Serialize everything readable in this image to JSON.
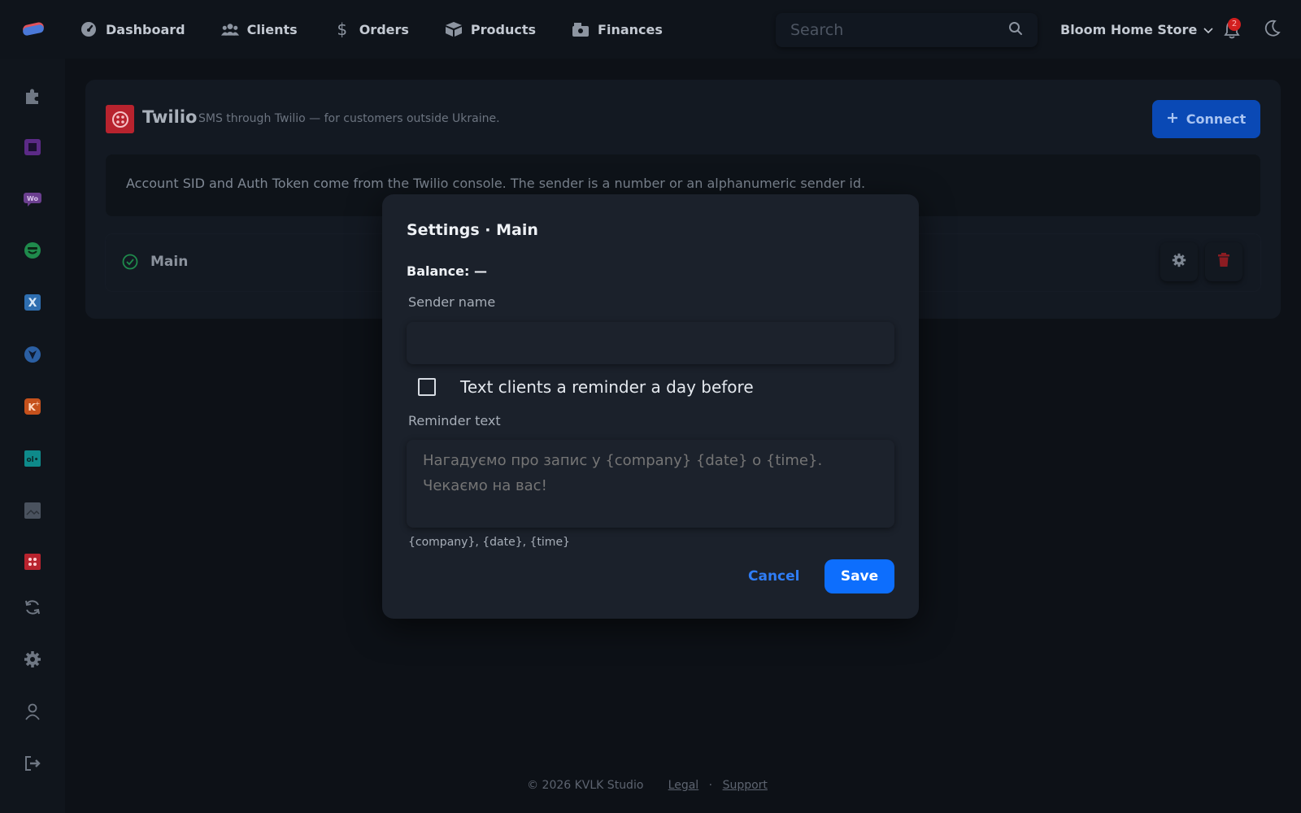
{
  "nav": {
    "items": [
      {
        "label": "Dashboard",
        "icon": "gauge-icon"
      },
      {
        "label": "Clients",
        "icon": "users-icon"
      },
      {
        "label": "Orders",
        "icon": "dollar-icon"
      },
      {
        "label": "Products",
        "icon": "box-icon"
      },
      {
        "label": "Finances",
        "icon": "cash-register-icon"
      }
    ],
    "search_placeholder": "Search",
    "store_name": "Bloom Home Store",
    "notification_count": "2"
  },
  "sidebar": {
    "items": [
      "puzzle-icon",
      "square-app-icon",
      "woo-icon",
      "smiley-app-icon",
      "x-app-icon",
      "shield-app-icon",
      "k-plus-app-icon",
      "olx-app-icon",
      "image-app-icon",
      "twilio-app-icon",
      "sync-icon",
      "gear-icon",
      "user-icon",
      "logout-icon"
    ]
  },
  "integration": {
    "name": "Twilio",
    "description": "SMS through Twilio — for customers outside Ukraine.",
    "connect_label": "Connect",
    "info": "Account SID and Auth Token come from the Twilio console. The sender is a number or an alphanumeric sender id.",
    "account": {
      "label": "Main",
      "status": "connected"
    }
  },
  "modal": {
    "title": "Settings · Main",
    "balance": "Balance: —",
    "sender_label": "Sender name",
    "sender_value": "",
    "reminder_checkbox_label": "Text clients a reminder a day before",
    "reminder_checked": false,
    "reminder_text_label": "Reminder text",
    "reminder_text_placeholder": "Нагадуємо про запис у {company} {date} о {time}. Чекаємо на вас!",
    "placeholders_hint": "{company}, {date}, {time}",
    "cancel_label": "Cancel",
    "save_label": "Save"
  },
  "footer": {
    "copyright": "© 2026 KVLK Studio",
    "legal": "Legal",
    "separator": "·",
    "support": "Support"
  },
  "colors": {
    "primary": "#0d6efd",
    "danger": "#d21f1f",
    "success": "#1f8a4c",
    "background": "#0d1117"
  }
}
